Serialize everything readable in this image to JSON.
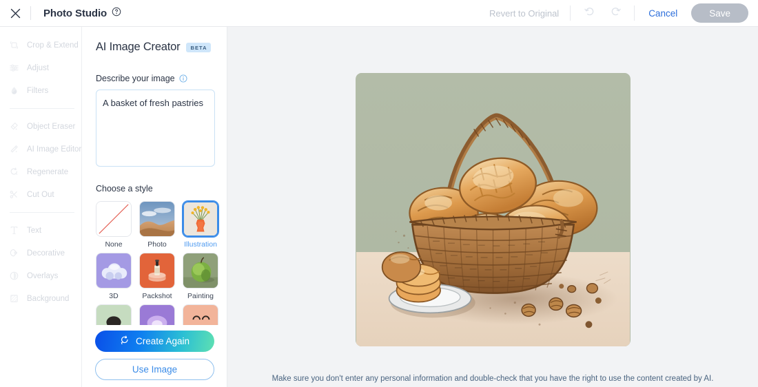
{
  "topbar": {
    "close_icon": "close-icon",
    "app_title": "Photo Studio",
    "help_icon": "help-circle-icon",
    "revert_label": "Revert to Original",
    "undo_icon": "undo-arrow-icon",
    "redo_icon": "redo-arrow-icon",
    "cancel_label": "Cancel",
    "save_label": "Save"
  },
  "sidebar": {
    "groups": [
      {
        "items": [
          {
            "label": "Crop & Extend",
            "icon": "crop-icon"
          },
          {
            "label": "Adjust",
            "icon": "sliders-icon"
          },
          {
            "label": "Filters",
            "icon": "droplet-icon"
          }
        ]
      },
      {
        "items": [
          {
            "label": "Object Eraser",
            "icon": "eraser-sparkle-icon"
          },
          {
            "label": "AI Image Editor",
            "icon": "magic-wand-icon"
          },
          {
            "label": "Regenerate",
            "icon": "refresh-sparkle-icon"
          },
          {
            "label": "Cut Out",
            "icon": "scissors-icon"
          }
        ]
      },
      {
        "items": [
          {
            "label": "Text",
            "icon": "text-t-icon"
          },
          {
            "label": "Decorative",
            "icon": "decorative-shape-icon"
          },
          {
            "label": "Overlays",
            "icon": "overlay-layers-icon"
          },
          {
            "label": "Background",
            "icon": "background-hatch-icon"
          }
        ]
      }
    ]
  },
  "panel": {
    "title": "AI Image Creator",
    "badge": "BETA",
    "prompt_field": {
      "label": "Describe your image",
      "info_icon": "info-circle-icon",
      "value": "A basket of fresh pastries",
      "placeholder": "Describe your image"
    },
    "style_section": {
      "label": "Choose a style",
      "selected": "Illustration",
      "styles": [
        {
          "label": "None",
          "thumb": "none-diagonal-slash",
          "selected": false
        },
        {
          "label": "Photo",
          "thumb": "desert-dunes-photo",
          "selected": false
        },
        {
          "label": "Illustration",
          "thumb": "orange-vase-flowers",
          "selected": true
        },
        {
          "label": "3D",
          "thumb": "purple-3d-clouds",
          "selected": false
        },
        {
          "label": "Packshot",
          "thumb": "orange-bottle-podium",
          "selected": false
        },
        {
          "label": "Painting",
          "thumb": "green-apple-painting",
          "selected": false
        },
        {
          "label": "",
          "thumb": "green-partial-row",
          "selected": false
        },
        {
          "label": "",
          "thumb": "purple-partial-row",
          "selected": false
        },
        {
          "label": "",
          "thumb": "peach-partial-row",
          "selected": false
        }
      ]
    },
    "create_button": {
      "label": "Create Again",
      "icon": "refresh-icon"
    },
    "use_button": {
      "label": "Use Image"
    }
  },
  "canvas": {
    "generated_image": {
      "alt": "Illustration of a wicker basket filled with fresh baked pastries, with a small plate of pastries and scattered nuts on a table"
    },
    "disclaimer": "Make sure you don't enter any personal information and double-check that you have the right to use the content created by AI."
  },
  "colors": {
    "accent_blue": "#3b8ce8",
    "link_blue": "#2d6fdb",
    "gradient_start": "#0a4fe8",
    "gradient_end": "#5ee0b2",
    "badge_bg": "#cfe6fa",
    "disabled_gray": "#b7bdc7",
    "canvas_bg": "#f2f3f5",
    "image_bg": "#b4bda9",
    "text_dark": "#2b3445"
  }
}
